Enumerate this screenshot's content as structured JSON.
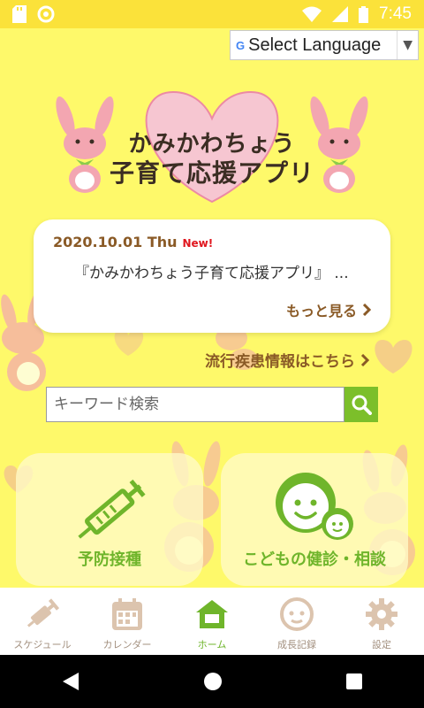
{
  "status_bar": {
    "time": "7:45",
    "icons": [
      "sd-card-icon",
      "circle-icon",
      "wifi-icon",
      "signal-icon",
      "battery-icon"
    ]
  },
  "translate": {
    "label": "Select Language",
    "google_mark": "G"
  },
  "logo": {
    "line1": "かみかわちょう",
    "line2": "子育て応援アプリ"
  },
  "news": {
    "date": "2020.10.01 Thu",
    "badge": "New!",
    "title": "『かみかわちょう子育て応援アプリ』 ...",
    "more": "もっと見る"
  },
  "disease_link": "流行疾患情報はこちら",
  "search": {
    "placeholder": "キーワード検索"
  },
  "tiles": [
    {
      "label": "予防接種",
      "icon": "syringe-icon"
    },
    {
      "label": "こどもの健診・相談",
      "icon": "child-faces-icon"
    }
  ],
  "bottom_nav": [
    {
      "label": "スケジュール",
      "icon": "syringe-icon",
      "active": false
    },
    {
      "label": "カレンダー",
      "icon": "calendar-icon",
      "active": false
    },
    {
      "label": "ホーム",
      "icon": "home-icon",
      "active": true
    },
    {
      "label": "成長記録",
      "icon": "baby-face-icon",
      "active": false
    },
    {
      "label": "設定",
      "icon": "gear-icon",
      "active": false
    }
  ],
  "colors": {
    "background": "#fef96a",
    "status_bar": "#fbe23a",
    "accent_green": "#6fb52b",
    "brown_text": "#8a5a26",
    "new_red": "#e0161e",
    "rabbit_pink": "#f3a6b1"
  }
}
